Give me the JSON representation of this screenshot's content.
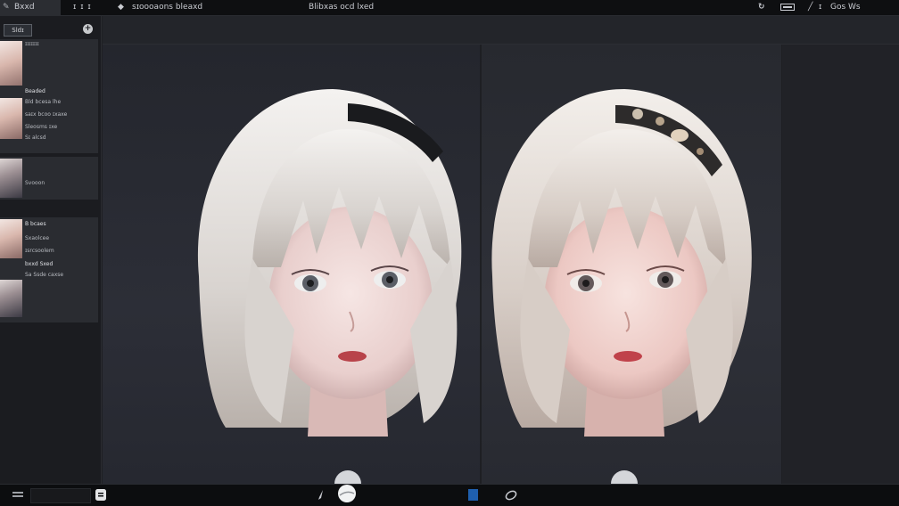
{
  "topbar": {
    "left_label": "Bxxd",
    "menu_marks": "ɪ  ɪ ɪ",
    "title": "sɪoooaons  bleaxd",
    "center_title": "Blibxas ocd  lxed",
    "right_label": "Gos  Ws"
  },
  "sidebar": {
    "tab_label": "Sldɪ",
    "add_icon": "plus-icon",
    "cards": [
      {
        "lines": [
          "ɪɪɪɪɪɪɪ"
        ]
      },
      {
        "lines": [
          "Beaded",
          "Bld bcesa  lhe",
          "saɪx bcoo ɪxaxe",
          "Sleosms  ɪxe",
          "Sɪ  alcsd"
        ]
      },
      {
        "lines": [
          "Svooon"
        ]
      },
      {
        "lines": [
          "B bcaes",
          "Sxaolcee",
          "ɪsrcsoolem",
          "bxxd Sxed",
          "Sa  Ssde caxse"
        ]
      }
    ]
  },
  "bottombar": {
    "icons": [
      "menu-icon",
      "panel-icon",
      "brush-icon",
      "sphere-icon",
      "color-swatch-icon",
      "shape-icon"
    ]
  },
  "colors": {
    "accent_blue": "#1f5fae",
    "bg": "#1e1f23",
    "panel": "#2a2c31"
  }
}
